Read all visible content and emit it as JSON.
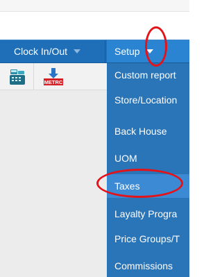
{
  "navbar": {
    "clock_label": "Clock In/Out",
    "setup_label": "Setup"
  },
  "toolbar": {
    "icons": [
      "cash-register-icon",
      "metrc-download-icon"
    ],
    "metrc_label": "METRC"
  },
  "dropdown": {
    "items": [
      {
        "label": "Custom report"
      },
      {
        "label": "Store/Location"
      },
      {
        "label": "Back House"
      },
      {
        "label": "UOM"
      },
      {
        "label": "Taxes"
      },
      {
        "label": "Layalty Progra"
      },
      {
        "label": "Price Groups/T"
      },
      {
        "label": "Commissions"
      }
    ],
    "active_item": "Taxes"
  },
  "annotations": {
    "color": "#e3131a",
    "highlighted": [
      "setup-caret",
      "taxes"
    ]
  },
  "colors": {
    "navbar": "#1f6fb8",
    "dropdown": "#2a74b8",
    "active": "#3c8ad4"
  }
}
